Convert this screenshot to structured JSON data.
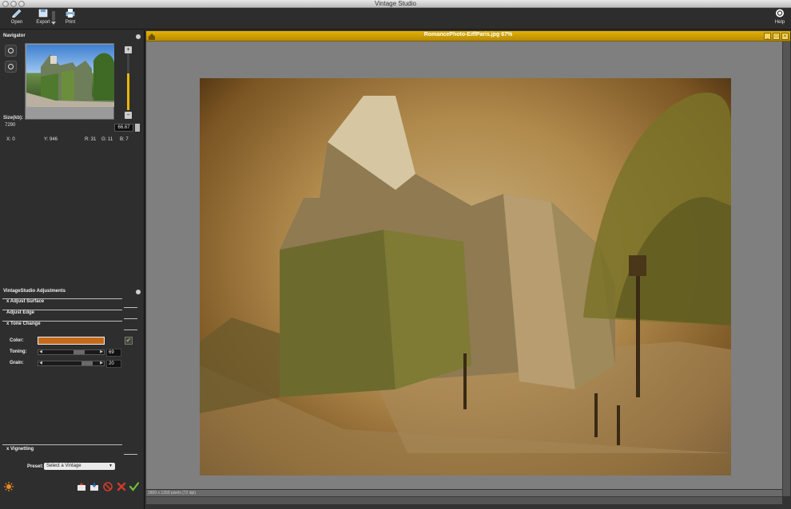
{
  "window": {
    "title": "Vintage Studio"
  },
  "toolbar": {
    "open_label": "Open",
    "export_label": "Export",
    "print_label": "Print",
    "help_label": "Help"
  },
  "navigator": {
    "title": "Navigator",
    "size_label": "Size(kb):",
    "size_value": "7290",
    "zoom_value": "66.67",
    "zoom_in_glyph": "+",
    "zoom_out_glyph": "−",
    "readout": {
      "x": "X: 0",
      "y": "Y: 946",
      "r": "R: 31",
      "g": "G: 11",
      "b": "B: 7"
    }
  },
  "adjustments": {
    "title": "VintageStudio Adjustments",
    "sections": {
      "adjust_surface": "x Adjust Surface",
      "adjust_edge": "Adjust Edge",
      "tone_change": "x Tone Change",
      "vignetting": "x Vignetting"
    },
    "tone": {
      "color_label": "Color:",
      "color_value": "#c46a1c",
      "toning_label": "Toning:",
      "toning_value": "69",
      "grain_label": "Grain:",
      "grain_value": "20"
    },
    "preset": {
      "label": "Preset:",
      "selected": "Select a Vintage"
    }
  },
  "document": {
    "title": "RomancePhoto-EiffParis.jpg 67%",
    "status": "1800 x 1350 pixels (72 dpi)"
  },
  "colors": {
    "accent": "#e3b208",
    "apply_green": "#6cc33a",
    "cancel_red": "#d23a2a",
    "sun_orange": "#f08a1c"
  }
}
